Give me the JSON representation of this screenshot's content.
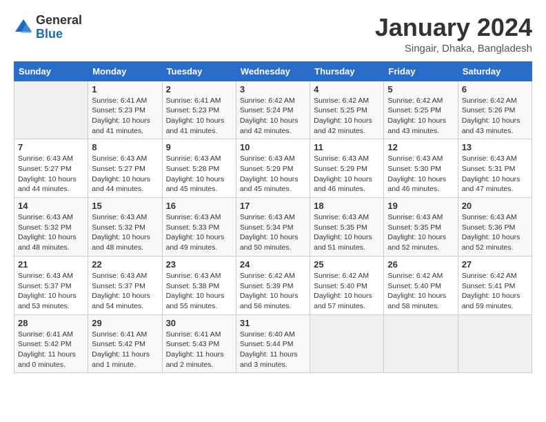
{
  "logo": {
    "general": "General",
    "blue": "Blue"
  },
  "header": {
    "month": "January 2024",
    "location": "Singair, Dhaka, Bangladesh"
  },
  "weekdays": [
    "Sunday",
    "Monday",
    "Tuesday",
    "Wednesday",
    "Thursday",
    "Friday",
    "Saturday"
  ],
  "weeks": [
    [
      {
        "day": null
      },
      {
        "day": 1,
        "sunrise": "6:41 AM",
        "sunset": "5:23 PM",
        "daylight": "10 hours and 41 minutes."
      },
      {
        "day": 2,
        "sunrise": "6:41 AM",
        "sunset": "5:23 PM",
        "daylight": "10 hours and 41 minutes."
      },
      {
        "day": 3,
        "sunrise": "6:42 AM",
        "sunset": "5:24 PM",
        "daylight": "10 hours and 42 minutes."
      },
      {
        "day": 4,
        "sunrise": "6:42 AM",
        "sunset": "5:25 PM",
        "daylight": "10 hours and 42 minutes."
      },
      {
        "day": 5,
        "sunrise": "6:42 AM",
        "sunset": "5:25 PM",
        "daylight": "10 hours and 43 minutes."
      },
      {
        "day": 6,
        "sunrise": "6:42 AM",
        "sunset": "5:26 PM",
        "daylight": "10 hours and 43 minutes."
      }
    ],
    [
      {
        "day": 7,
        "sunrise": "6:43 AM",
        "sunset": "5:27 PM",
        "daylight": "10 hours and 44 minutes."
      },
      {
        "day": 8,
        "sunrise": "6:43 AM",
        "sunset": "5:27 PM",
        "daylight": "10 hours and 44 minutes."
      },
      {
        "day": 9,
        "sunrise": "6:43 AM",
        "sunset": "5:28 PM",
        "daylight": "10 hours and 45 minutes."
      },
      {
        "day": 10,
        "sunrise": "6:43 AM",
        "sunset": "5:29 PM",
        "daylight": "10 hours and 45 minutes."
      },
      {
        "day": 11,
        "sunrise": "6:43 AM",
        "sunset": "5:29 PM",
        "daylight": "10 hours and 46 minutes."
      },
      {
        "day": 12,
        "sunrise": "6:43 AM",
        "sunset": "5:30 PM",
        "daylight": "10 hours and 46 minutes."
      },
      {
        "day": 13,
        "sunrise": "6:43 AM",
        "sunset": "5:31 PM",
        "daylight": "10 hours and 47 minutes."
      }
    ],
    [
      {
        "day": 14,
        "sunrise": "6:43 AM",
        "sunset": "5:32 PM",
        "daylight": "10 hours and 48 minutes."
      },
      {
        "day": 15,
        "sunrise": "6:43 AM",
        "sunset": "5:32 PM",
        "daylight": "10 hours and 48 minutes."
      },
      {
        "day": 16,
        "sunrise": "6:43 AM",
        "sunset": "5:33 PM",
        "daylight": "10 hours and 49 minutes."
      },
      {
        "day": 17,
        "sunrise": "6:43 AM",
        "sunset": "5:34 PM",
        "daylight": "10 hours and 50 minutes."
      },
      {
        "day": 18,
        "sunrise": "6:43 AM",
        "sunset": "5:35 PM",
        "daylight": "10 hours and 51 minutes."
      },
      {
        "day": 19,
        "sunrise": "6:43 AM",
        "sunset": "5:35 PM",
        "daylight": "10 hours and 52 minutes."
      },
      {
        "day": 20,
        "sunrise": "6:43 AM",
        "sunset": "5:36 PM",
        "daylight": "10 hours and 52 minutes."
      }
    ],
    [
      {
        "day": 21,
        "sunrise": "6:43 AM",
        "sunset": "5:37 PM",
        "daylight": "10 hours and 53 minutes."
      },
      {
        "day": 22,
        "sunrise": "6:43 AM",
        "sunset": "5:37 PM",
        "daylight": "10 hours and 54 minutes."
      },
      {
        "day": 23,
        "sunrise": "6:43 AM",
        "sunset": "5:38 PM",
        "daylight": "10 hours and 55 minutes."
      },
      {
        "day": 24,
        "sunrise": "6:42 AM",
        "sunset": "5:39 PM",
        "daylight": "10 hours and 56 minutes."
      },
      {
        "day": 25,
        "sunrise": "6:42 AM",
        "sunset": "5:40 PM",
        "daylight": "10 hours and 57 minutes."
      },
      {
        "day": 26,
        "sunrise": "6:42 AM",
        "sunset": "5:40 PM",
        "daylight": "10 hours and 58 minutes."
      },
      {
        "day": 27,
        "sunrise": "6:42 AM",
        "sunset": "5:41 PM",
        "daylight": "10 hours and 59 minutes."
      }
    ],
    [
      {
        "day": 28,
        "sunrise": "6:41 AM",
        "sunset": "5:42 PM",
        "daylight": "11 hours and 0 minutes."
      },
      {
        "day": 29,
        "sunrise": "6:41 AM",
        "sunset": "5:42 PM",
        "daylight": "11 hours and 1 minute."
      },
      {
        "day": 30,
        "sunrise": "6:41 AM",
        "sunset": "5:43 PM",
        "daylight": "11 hours and 2 minutes."
      },
      {
        "day": 31,
        "sunrise": "6:40 AM",
        "sunset": "5:44 PM",
        "daylight": "11 hours and 3 minutes."
      },
      {
        "day": null
      },
      {
        "day": null
      },
      {
        "day": null
      }
    ]
  ]
}
